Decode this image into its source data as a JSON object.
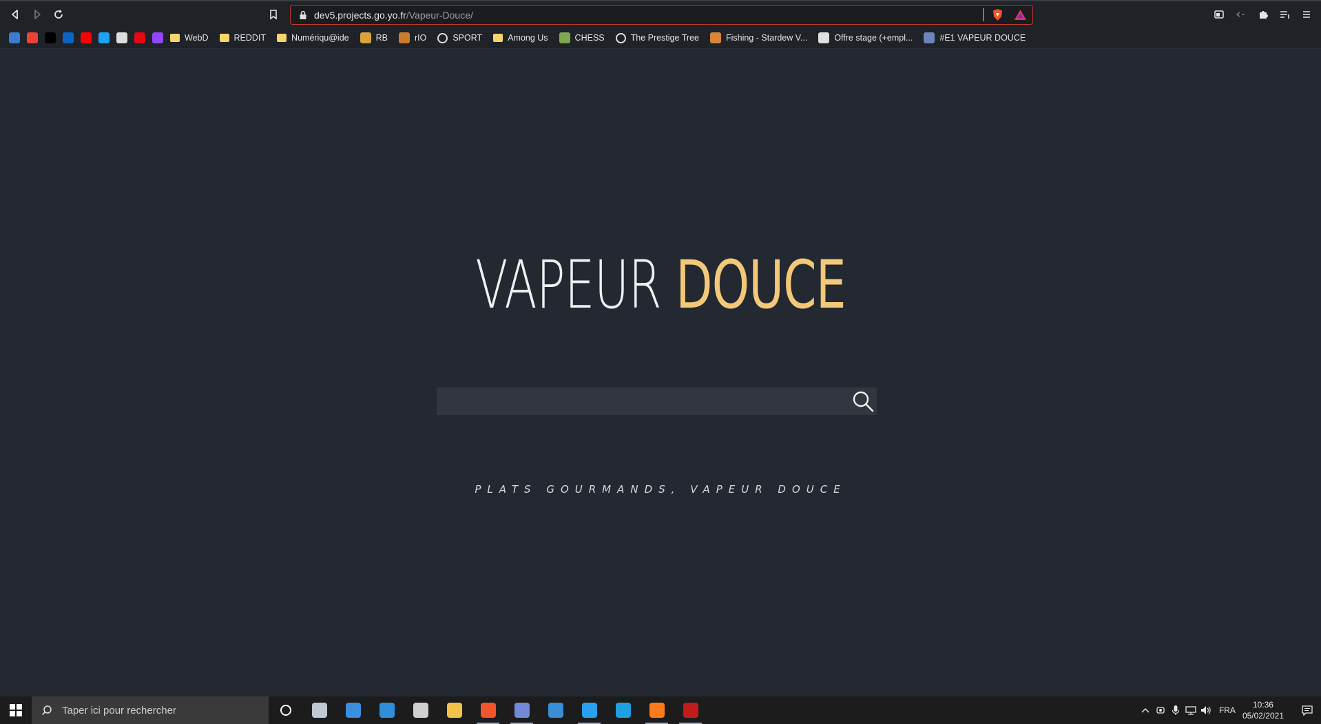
{
  "browser": {
    "url_host": "dev5.projects.go.yo.fr",
    "url_path": "/Vapeur-Douce/",
    "accent": "#c23a2c"
  },
  "bookmarks": [
    {
      "label": "",
      "icon": "app-icon",
      "color": "#3b7bd0"
    },
    {
      "label": "",
      "icon": "gmail-icon",
      "color": "#ea4335"
    },
    {
      "label": "",
      "icon": "medium-icon",
      "color": "#000000"
    },
    {
      "label": "",
      "icon": "outlook-icon",
      "color": "#0a64c6"
    },
    {
      "label": "",
      "icon": "youtube-icon",
      "color": "#ff0000"
    },
    {
      "label": "",
      "icon": "twitter-icon",
      "color": "#1da1f2"
    },
    {
      "label": "",
      "icon": "ghost-icon",
      "color": "#dddddd"
    },
    {
      "label": "",
      "icon": "netflix-icon",
      "color": "#e50914"
    },
    {
      "label": "",
      "icon": "twitch-icon",
      "color": "#9146ff"
    },
    {
      "label": "WebD",
      "icon": "folder-icon"
    },
    {
      "label": "REDDIT",
      "icon": "folder-icon"
    },
    {
      "label": "Numériqu@ide",
      "icon": "folder-icon"
    },
    {
      "label": "RB",
      "icon": "bee-icon",
      "color": "#d9a23a"
    },
    {
      "label": "rIO",
      "icon": "rio-icon",
      "color": "#c87c2c"
    },
    {
      "label": "SPORT",
      "icon": "globe-icon",
      "color": "#e0e0e0"
    },
    {
      "label": "Among Us",
      "icon": "folder-icon"
    },
    {
      "label": "CHESS",
      "icon": "chess-icon",
      "color": "#7fa650"
    },
    {
      "label": "The Prestige Tree",
      "icon": "globe-icon",
      "color": "#e0e0e0"
    },
    {
      "label": "Fishing - Stardew V...",
      "icon": "stardew-icon",
      "color": "#d8843a"
    },
    {
      "label": "Offre stage (+empl...",
      "icon": "doc-icon",
      "color": "#e0e0e0"
    },
    {
      "label": "#E1 VAPEUR DOUCE",
      "icon": "shield-icon",
      "color": "#6a86b8"
    }
  ],
  "page": {
    "logo_part1": "VAPEUR",
    "logo_part2": "DOUCE",
    "logo_accent": "#f3c879",
    "search_placeholder": "",
    "tagline": "PLATS GOURMANDS, VAPEUR DOUCE",
    "background": "#232831"
  },
  "taskbar": {
    "search_placeholder": "Taper ici pour rechercher",
    "apps": [
      {
        "icon": "cortana-icon",
        "color": "#ffffff"
      },
      {
        "icon": "paint-icon",
        "color": "#c0c8d4"
      },
      {
        "icon": "explorer-window-icon",
        "color": "#3c8ee0"
      },
      {
        "icon": "notepad-icon",
        "color": "#2f8fd8"
      },
      {
        "icon": "monitor-icon",
        "color": "#d0d0d0"
      },
      {
        "icon": "file-explorer-icon",
        "color": "#f2c24a"
      },
      {
        "icon": "brave-icon",
        "color": "#f2542d",
        "active": true
      },
      {
        "icon": "discord-icon",
        "color": "#7289da",
        "active": true
      },
      {
        "icon": "visual-studio-icon",
        "color": "#3a8ed6"
      },
      {
        "icon": "vscode-icon",
        "color": "#2aa0f0",
        "active": true
      },
      {
        "icon": "edge-icon",
        "color": "#1fa0e0"
      },
      {
        "icon": "firefox-icon",
        "color": "#ff7a1a",
        "active": true
      },
      {
        "icon": "filezilla-icon",
        "color": "#c21b1b",
        "active": true
      }
    ],
    "language": "FRA",
    "time": "10:36",
    "date": "05/02/2021"
  }
}
